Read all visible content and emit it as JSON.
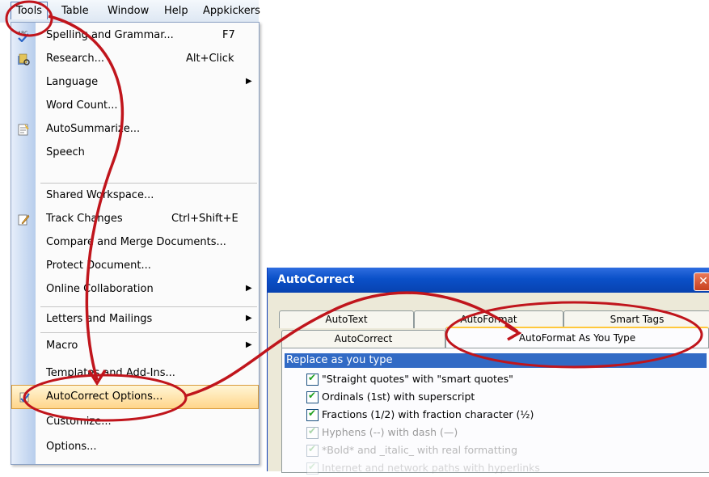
{
  "menubar": {
    "items": [
      "Tools",
      "Table",
      "Window",
      "Help",
      "Appkickers"
    ]
  },
  "tools_menu": {
    "items": [
      {
        "label": "Spelling and Grammar...",
        "shortcut": "F7",
        "icon": "spelling-icon"
      },
      {
        "label": "Research...",
        "shortcut": "Alt+Click",
        "icon": "research-icon"
      },
      {
        "label": "Language",
        "submenu": true
      },
      {
        "label": "Word Count..."
      },
      {
        "label": "AutoSummarize...",
        "icon": "autosummarize-icon"
      },
      {
        "label": "Speech"
      },
      {
        "label": "Shared Workspace..."
      },
      {
        "label": "Track Changes",
        "shortcut": "Ctrl+Shift+E",
        "icon": "track-changes-icon"
      },
      {
        "label": "Compare and Merge Documents..."
      },
      {
        "label": "Protect Document..."
      },
      {
        "label": "Online Collaboration",
        "submenu": true
      },
      {
        "label": "Letters and Mailings",
        "submenu": true
      },
      {
        "label": "Macro",
        "submenu": true
      },
      {
        "label": "Templates and Add-Ins..."
      },
      {
        "label": "AutoCorrect Options...",
        "icon": "autocorrect-icon",
        "highlighted": true
      },
      {
        "label": "Customize..."
      },
      {
        "label": "Options..."
      }
    ]
  },
  "dialog": {
    "title": "AutoCorrect",
    "close_glyph": "✕",
    "tabs_back": [
      "AutoText",
      "AutoFormat",
      "Smart Tags"
    ],
    "tabs_front": [
      "AutoCorrect",
      "AutoFormat As You Type"
    ],
    "selected_tab": "AutoFormat As You Type",
    "group_label": "Replace as you type",
    "options": [
      {
        "label": "\"Straight quotes\" with \"smart quotes\"",
        "checked": true
      },
      {
        "label": "Ordinals (1st) with superscript",
        "checked": true
      },
      {
        "label": "Fractions (1/2) with fraction character (½)",
        "checked": true
      },
      {
        "label": "Hyphens (--) with dash (—)",
        "checked": true
      },
      {
        "label": "*Bold* and _italic_ with real formatting",
        "checked": true
      },
      {
        "label": "Internet and network paths with hyperlinks",
        "checked": true
      }
    ]
  },
  "colors": {
    "annotation": "#c0151c",
    "titlebar": "#0a50c8",
    "menu_highlight": "#ffd58a"
  }
}
